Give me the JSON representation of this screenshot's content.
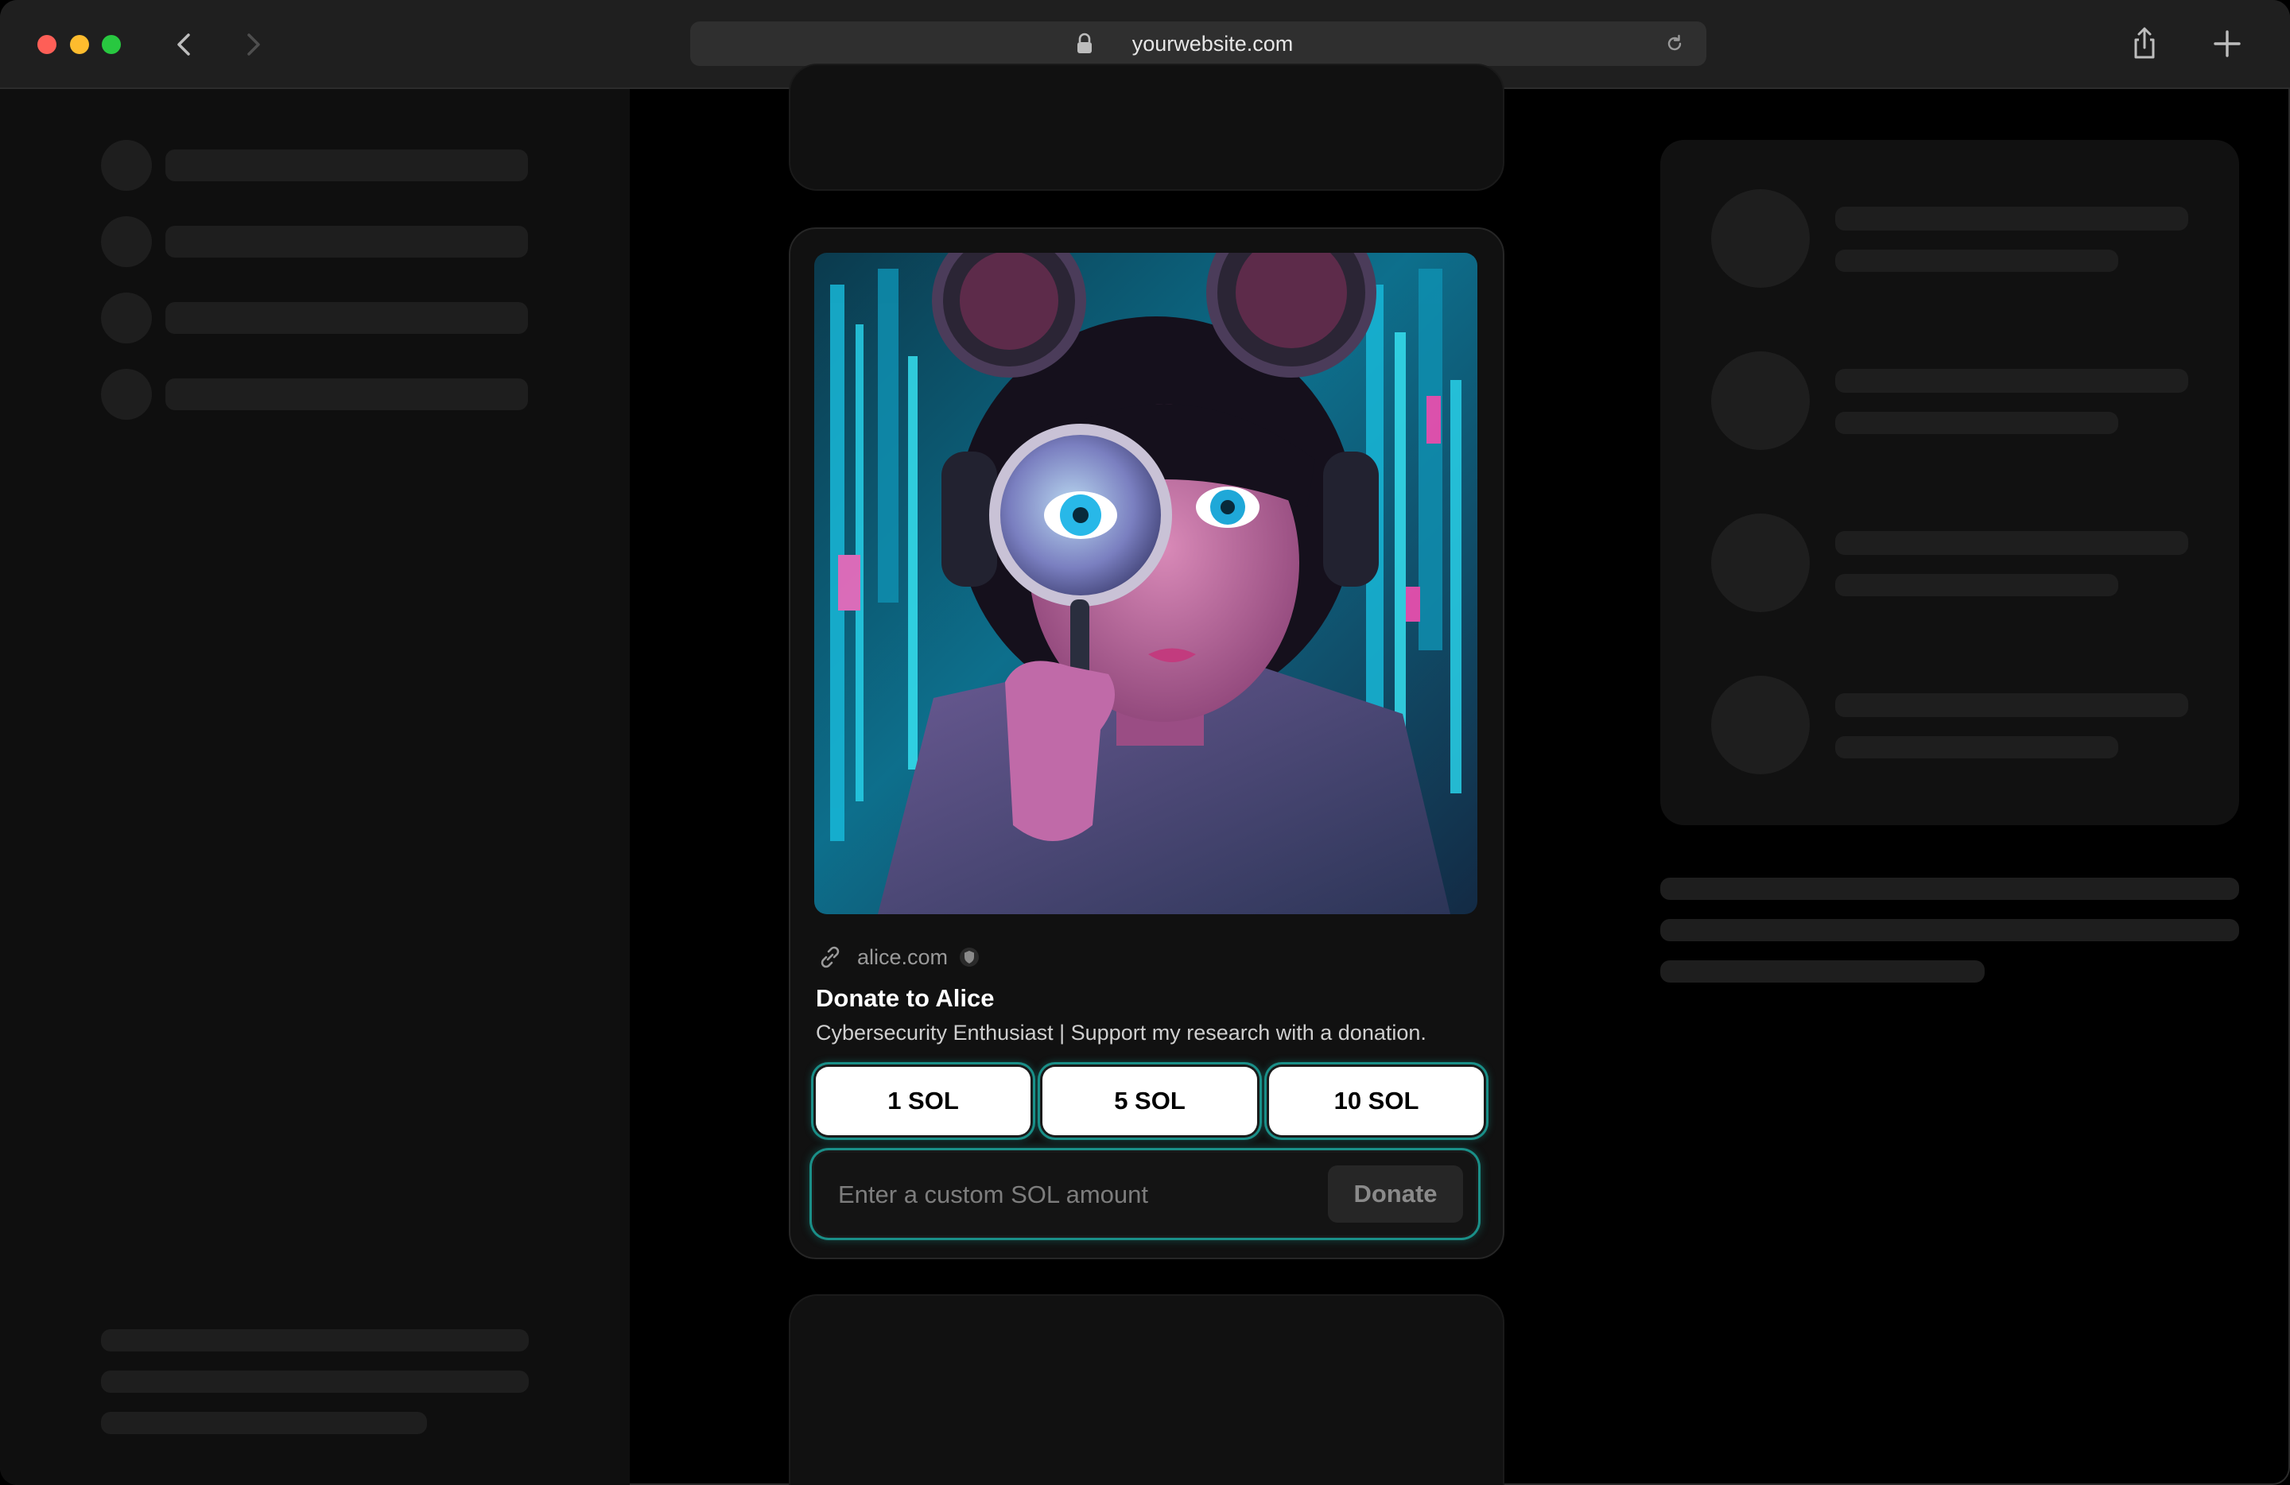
{
  "browser": {
    "url": "yourwebsite.com"
  },
  "card": {
    "link_text": "alice.com",
    "title": "Donate to Alice",
    "description": "Cybersecurity Enthusiast | Support my research with a donation.",
    "amount_buttons": [
      "1 SOL",
      "5 SOL",
      "10 SOL"
    ],
    "custom_placeholder": "Enter a custom SOL amount",
    "donate_label": "Donate"
  },
  "colors": {
    "accent_glow": "#1ec8be",
    "card_bg": "#111111",
    "skeleton": "#1e1e1e"
  }
}
